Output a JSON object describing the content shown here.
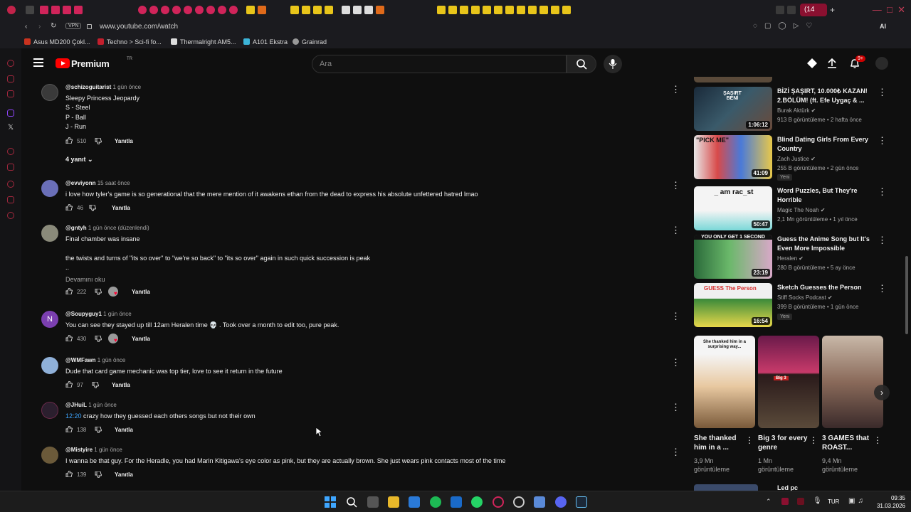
{
  "browser": {
    "url": "www.youtube.com/watch",
    "vpn_label": "VPN",
    "active_tab_label": "(14",
    "bookmarks": [
      {
        "label": "Asus MD200 Çokl..."
      },
      {
        "label": "Techno > Sci-fi fo..."
      },
      {
        "label": "Thermalright AM5..."
      },
      {
        "label": "A101 Ekstra"
      },
      {
        "label": "Grainrad"
      }
    ]
  },
  "header": {
    "logo_text": "Premium",
    "region": "TR",
    "search_placeholder": "Ara",
    "notif_count": "9+"
  },
  "comments": [
    {
      "author": "@schizoguitarist",
      "time": "1 gün önce",
      "text": "Sleepy Princess Jeopardy\nS - Steel\nP - Ball\nJ - Run",
      "likes": "510",
      "reply_label": "Yanıtla",
      "replies_label": "4 yanıt",
      "avatar_color": "#3a3a3a"
    },
    {
      "author": "@evviyonn",
      "time": "15 saat önce",
      "text": "i love how tyler's game is so generational that the mere mention of it awakens ethan from the dead to express his absolute unfettered hatred lmao",
      "likes": "46",
      "reply_label": "Yanıtla",
      "avatar_color": "#6a6fb8"
    },
    {
      "author": "@gntyh",
      "time": "1 gün önce (düzenlendi)",
      "text": "Final chamber was insane\n\nthe twists and turns of \"its so over\" to \"we're so back\" to \"its so over\" again in such quick succession is peak\n..",
      "more_label": "Devamını oku",
      "likes": "222",
      "reply_label": "Yanıtla",
      "avatar_color": "#8a8a7a"
    },
    {
      "author": "@Soupyguy1",
      "time": "1 gün önce",
      "text": "You can see they stayed up till 12am Heralen time 💀 . Took over a month to edit too, pure peak.",
      "likes": "430",
      "reply_label": "Yanıtla",
      "avatar_letter": "N",
      "avatar_color": "#7b3fb0"
    },
    {
      "author": "@WMFawn",
      "time": "1 gün önce",
      "text": "Dude that card game mechanic was top tier, love to see it return in the future",
      "likes": "97",
      "reply_label": "Yanıtla",
      "avatar_color": "#8fb0d8"
    },
    {
      "author": "@JHuiL",
      "time": "1 gün önce",
      "timestamp": "12:20",
      "text": " crazy how they guessed each others songs but not their own",
      "likes": "138",
      "reply_label": "Yanıtla",
      "avatar_color": "#2b1f2e"
    },
    {
      "author": "@Mistyire",
      "time": "1 gün önce",
      "text": "I wanna be that guy. For the Heradle, you had Marin Kitigawa's eye color as pink, but they are actually brown. She just wears pink contacts most of the time",
      "likes": "139",
      "reply_label": "Yanıtla",
      "avatar_color": "#6b5a3a"
    }
  ],
  "related": [
    {
      "title": "BİZİ ŞAŞIRT, 10.000₺ KAZAN! 2.BÖLÜM! (ft. Efe Uygaç & ...",
      "channel": "Burak Aktürk",
      "meta": "913 B görüntüleme • 2 hafta önce",
      "duration": "1:06:12",
      "thumb_text": "ŞAŞIRT BENİ"
    },
    {
      "title": "Blind Dating Girls From Every Country",
      "channel": "Zach Justice",
      "meta": "255 B görüntüleme • 2 gün önce",
      "duration": "41:09",
      "badge": "Yeni",
      "thumb_text": "\"PICK ME\""
    },
    {
      "title": "Word Puzzles, But They're Horrible",
      "channel": "Magic The Noah",
      "meta": "2,1 Mn görüntüleme • 1 yıl önce",
      "duration": "50:47",
      "thumb_text": "_ am rac_st"
    },
    {
      "title": "Guess the Anime Song but It's Even More Impossible",
      "channel": "Heralen",
      "meta": "280 B görüntüleme • 5 ay önce",
      "duration": "23:19",
      "thumb_text": "YOU ONLY GET 1 SECOND"
    },
    {
      "title": "Sketch Guesses the Person",
      "channel": "Stiff Socks Podcast",
      "meta": "399 B görüntüleme • 1 gün önce",
      "duration": "16:54",
      "badge": "Yeni",
      "thumb_text": "GUESS The Person"
    }
  ],
  "shorts": [
    {
      "title": "She thanked him in a ...",
      "views": "3,9 Mn görüntüleme",
      "thumb_text": "She thanked him in a surprising way..."
    },
    {
      "title": "Big 3 for every genre",
      "views": "1 Mn görüntüleme",
      "thumb_text": "Big 3"
    },
    {
      "title": "3 GAMES that ROAST...",
      "views": "9,4 Mn görüntüleme"
    }
  ],
  "next_short_title": "Led pc",
  "taskbar": {
    "lang": "TUR",
    "time": "09:35",
    "date": "31.03.2026"
  },
  "colors": {
    "accent_red": "#ff0000",
    "link_blue": "#3ea6ff",
    "background": "#0f0f0f"
  }
}
